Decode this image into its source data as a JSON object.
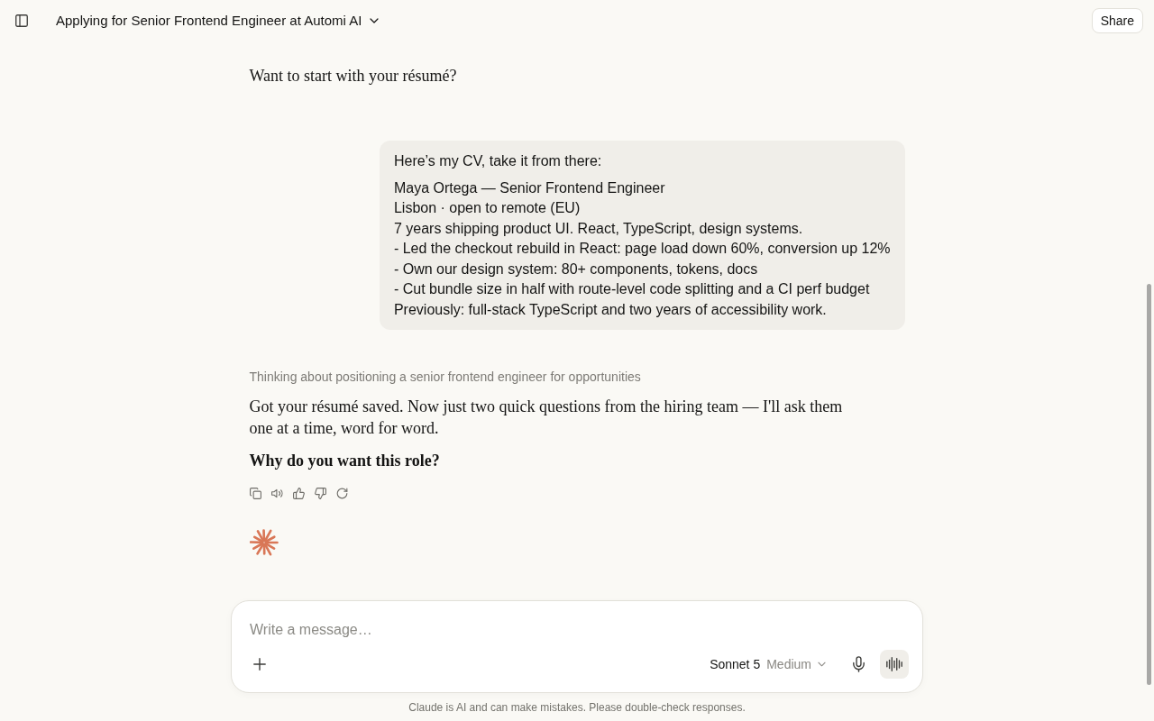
{
  "header": {
    "title": "Applying for Senior Frontend Engineer at Automi AI",
    "share_label": "Share"
  },
  "messages": [
    {
      "kind": "assistant",
      "actions": false,
      "paragraphs": [
        {
          "text": "Want to start with your résumé?",
          "bold": false
        }
      ]
    },
    {
      "kind": "user",
      "paragraphs": [
        {
          "text": "Here’s my CV, take it from there:"
        },
        {
          "text": "Maya Ortega — Senior Frontend Engineer\nLisbon · open to remote (EU)\n7 years shipping product UI. React, TypeScript, design systems.\n- Led the checkout rebuild in React: page load down 60%, conversion up 12%\n- Own our design system: 80+ components, tokens, docs\n- Cut bundle size in half with route-level code splitting and a CI perf budget\nPreviously: full-stack TypeScript and two years of accessibility work."
        }
      ]
    },
    {
      "kind": "assistant",
      "actions": true,
      "thinking": "Thinking about positioning a senior frontend engineer for opportunities",
      "paragraphs": [
        {
          "text": "Got your résumé saved. Now just two quick questions from the hiring team — I'll ask them one at a time, word for word.",
          "bold": false
        },
        {
          "text": "Why do you want this role?",
          "bold": true
        }
      ]
    }
  ],
  "composer": {
    "placeholder": "Write a message…",
    "model": "Sonnet 5",
    "effort": "Medium"
  },
  "disclaimer": "Claude is AI and can make mistakes. Please double-check responses."
}
